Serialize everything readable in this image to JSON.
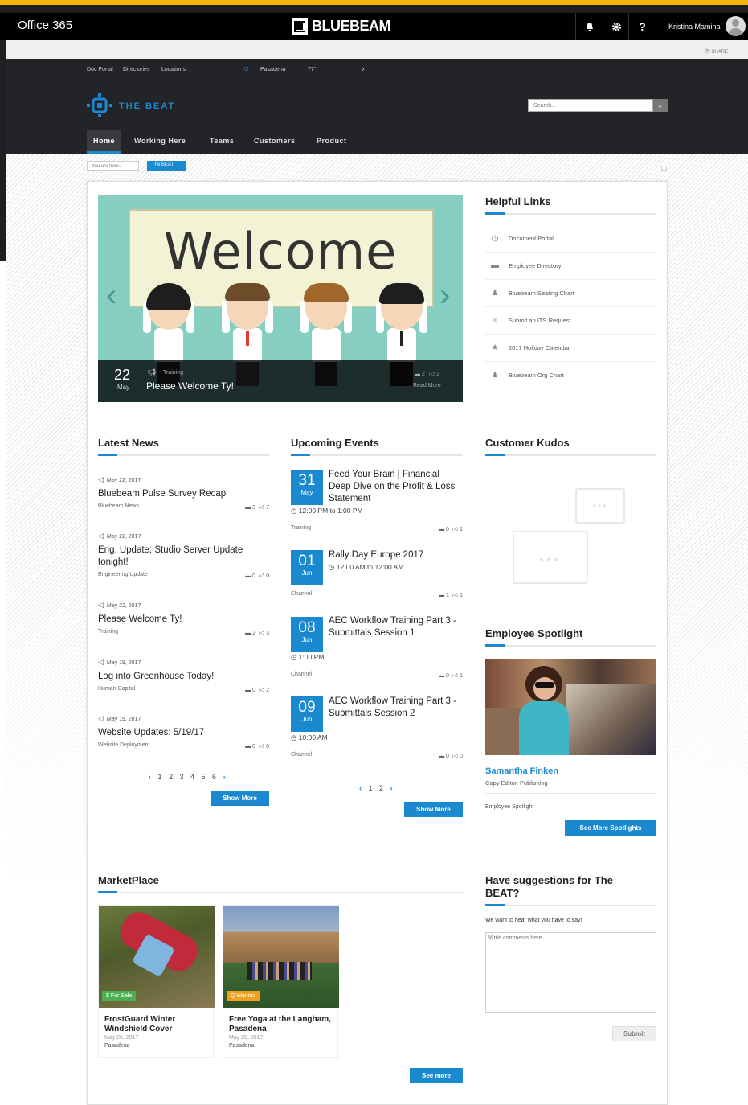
{
  "o365_bar": {
    "title": "Office 365",
    "brand": "BLUEBEAM",
    "user_name": "Kristina Mamina",
    "icons": [
      "bell-icon",
      "gear-icon",
      "help-icon"
    ],
    "help_glyph": "?"
  },
  "share_label": "SHARE",
  "top_links": [
    "Doc Portal",
    "Directories",
    "Locations"
  ],
  "weather": {
    "city": "Pasadena",
    "temp": "77°"
  },
  "logo_text": "THE BEAT",
  "search": {
    "placeholder": "Search..."
  },
  "nav": [
    {
      "label": "Home",
      "active": true
    },
    {
      "label": "Working Here"
    },
    {
      "label": "Teams"
    },
    {
      "label": "Customers"
    },
    {
      "label": "Product"
    }
  ],
  "breadcrumb": {
    "prefix": "You are here ▸",
    "current": "The BEAT"
  },
  "hero": {
    "banner_text": "Welcome",
    "day": "22",
    "month": "May",
    "category": "Training",
    "title": "Please Welcome Ty!",
    "comments": "2",
    "likes": "3",
    "read_more": "Read More"
  },
  "helpful_links": {
    "title": "Helpful Links",
    "items": [
      {
        "label": "Document Portal",
        "icon": "clock-icon"
      },
      {
        "label": "Employee Directory",
        "icon": "chat-icon"
      },
      {
        "label": "Bluebeam Seating Chart",
        "icon": "person-icon"
      },
      {
        "label": "Submit an ITS Request",
        "icon": "link-icon"
      },
      {
        "label": "2017 Holiday Calendar",
        "icon": "star-icon"
      },
      {
        "label": "Bluebeam Org Chart",
        "icon": "person-icon"
      }
    ]
  },
  "latest_news": {
    "title": "Latest News",
    "items": [
      {
        "date": "May 22, 2017",
        "title": "Bluebeam Pulse Survey Recap",
        "category": "Bluebeam News",
        "comments": "3",
        "likes": "7"
      },
      {
        "date": "May 22, 2017",
        "title": "Eng. Update: Studio Server Update tonight!",
        "category": "Engineering Update",
        "comments": "0",
        "likes": "0"
      },
      {
        "date": "May 22, 2017",
        "title": "Please Welcome Ty!",
        "category": "Training",
        "comments": "2",
        "likes": "3"
      },
      {
        "date": "May 19, 2017",
        "title": "Log into Greenhouse Today!",
        "category": "Human Capital",
        "comments": "0",
        "likes": "2"
      },
      {
        "date": "May 19, 2017",
        "title": "Website Updates: 5/19/17",
        "category": "Website Deployment",
        "comments": "0",
        "likes": "0"
      }
    ],
    "pager": "1 2 3 4 5 6",
    "show_more": "Show More"
  },
  "upcoming_events": {
    "title": "Upcoming Events",
    "items": [
      {
        "day": "31",
        "month": "May",
        "title": "Feed Your Brain | Financial Deep Dive on the Profit & Loss Statement",
        "time": "◷ 12:00 PM to 1:00 PM",
        "category": "Training",
        "comments": "0",
        "likes": "1"
      },
      {
        "day": "01",
        "month": "Jun",
        "title": "Rally Day Europe 2017",
        "time": "◷ 12:00 AM to 12:00 AM",
        "category": "Channel",
        "comments": "1",
        "likes": "1"
      },
      {
        "day": "08",
        "month": "Jun",
        "title": "AEC Workflow Training Part 3 - Submittals Session 1",
        "time": "◷ 1:00 PM",
        "category": "Channel",
        "comments": "0",
        "likes": "1"
      },
      {
        "day": "09",
        "month": "Jun",
        "title": "AEC Workflow Training Part 3 - Submittals Session 2",
        "time": "◷ 10:00 AM",
        "category": "Channel",
        "comments": "0",
        "likes": "0"
      }
    ],
    "pager": "1 2",
    "show_more": "Show More"
  },
  "customer_kudos": {
    "title": "Customer Kudos"
  },
  "employee_spotlight": {
    "title": "Employee Spotlight",
    "name": "Samantha Finken",
    "role": "Copy Editor, Publishing",
    "category": "Employee Spotlight",
    "button": "See More Spotlights"
  },
  "marketplace": {
    "title": "MarketPlace",
    "items": [
      {
        "tag": "$ For Sale",
        "title": "FrostGuard Winter Windshield Cover",
        "date": "May 26, 2017",
        "location": "Pasadena",
        "tag_color": "#4caf50"
      },
      {
        "tag": "Q Wanted",
        "title": "Free Yoga at the Langham, Pasadena",
        "date": "May 25, 2017",
        "location": "Pasadena",
        "tag_color": "#f0a020"
      }
    ],
    "see_more": "See more"
  },
  "suggestions": {
    "title": "Have suggestions for The BEAT?",
    "prompt": "We want to hear what you have to say!",
    "placeholder": "Write comments here",
    "submit": "Submit"
  },
  "colors": {
    "accent": "#1a89d0",
    "header_bg": "#232427",
    "gold": "#f4b400"
  }
}
